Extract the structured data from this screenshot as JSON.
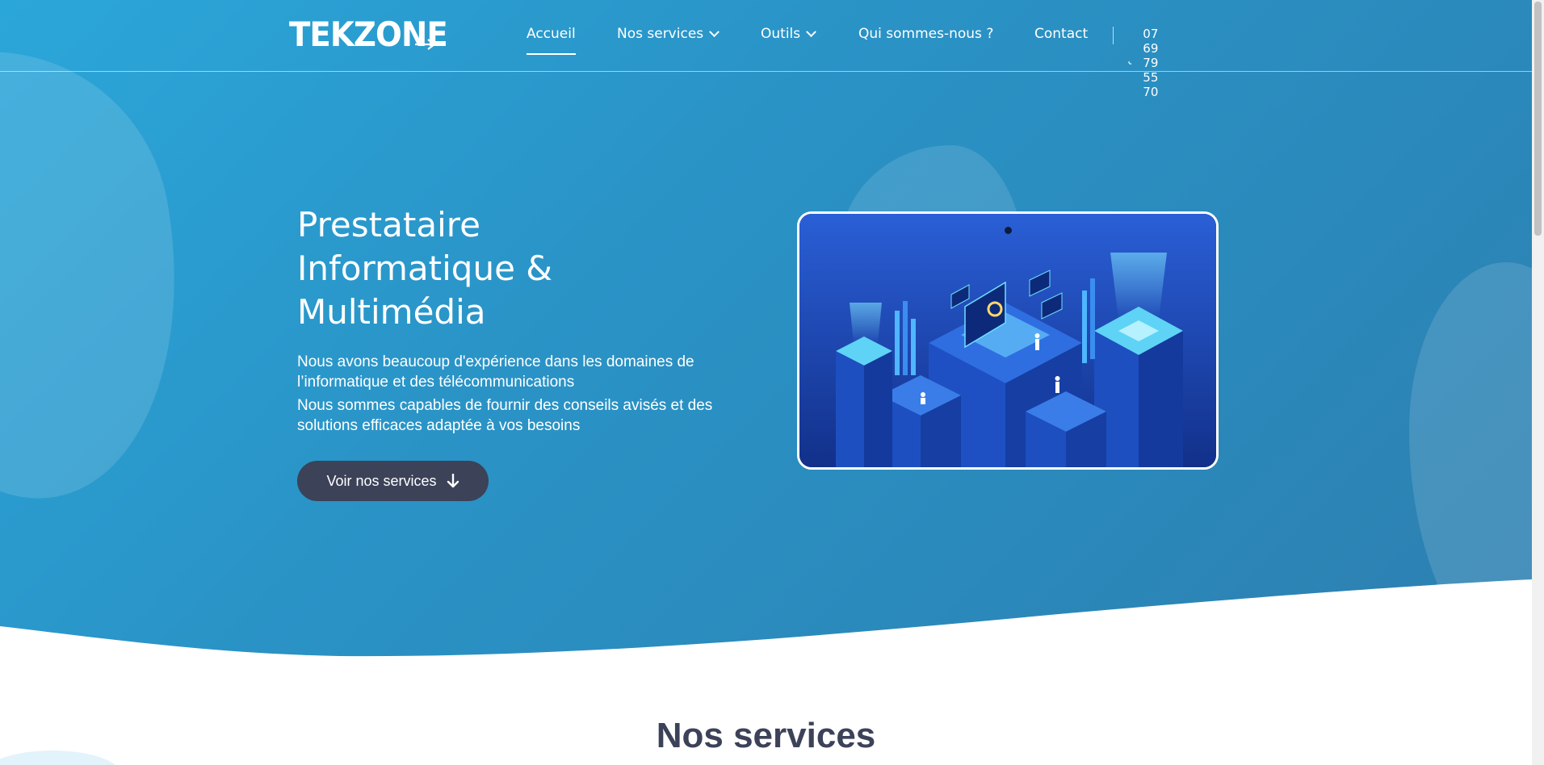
{
  "header": {
    "logo_text": "TEKZONE",
    "nav": [
      {
        "label": "Accueil",
        "active": true,
        "has_dropdown": false
      },
      {
        "label": "Nos services",
        "active": false,
        "has_dropdown": true
      },
      {
        "label": "Outils",
        "active": false,
        "has_dropdown": true
      },
      {
        "label": "Qui sommes-nous ?",
        "active": false,
        "has_dropdown": false
      },
      {
        "label": "Contact",
        "active": false,
        "has_dropdown": false
      }
    ],
    "phone": "07 69 79 55 70",
    "phone_icon": "phone-icon"
  },
  "hero": {
    "title_lines": [
      "Prestataire",
      "Informatique &",
      "Multimédia"
    ],
    "paragraphs": [
      "Nous avons beaucoup d'expérience dans les domaines de l’informatique et des télécommunications",
      "Nous sommes capables de fournir des conseils avisés et des solutions efficaces adaptée à vos besoins"
    ],
    "cta_label": "Voir nos services",
    "cta_icon": "arrow-down-icon"
  },
  "section": {
    "title": "Nos services"
  },
  "colors": {
    "hero_gradient_start": "#2ba6d9",
    "hero_gradient_end": "#2c7fb0",
    "button_bg": "#3c4258",
    "heading_dark": "#3c4258",
    "tablet_bg": "#1b3f9a"
  }
}
